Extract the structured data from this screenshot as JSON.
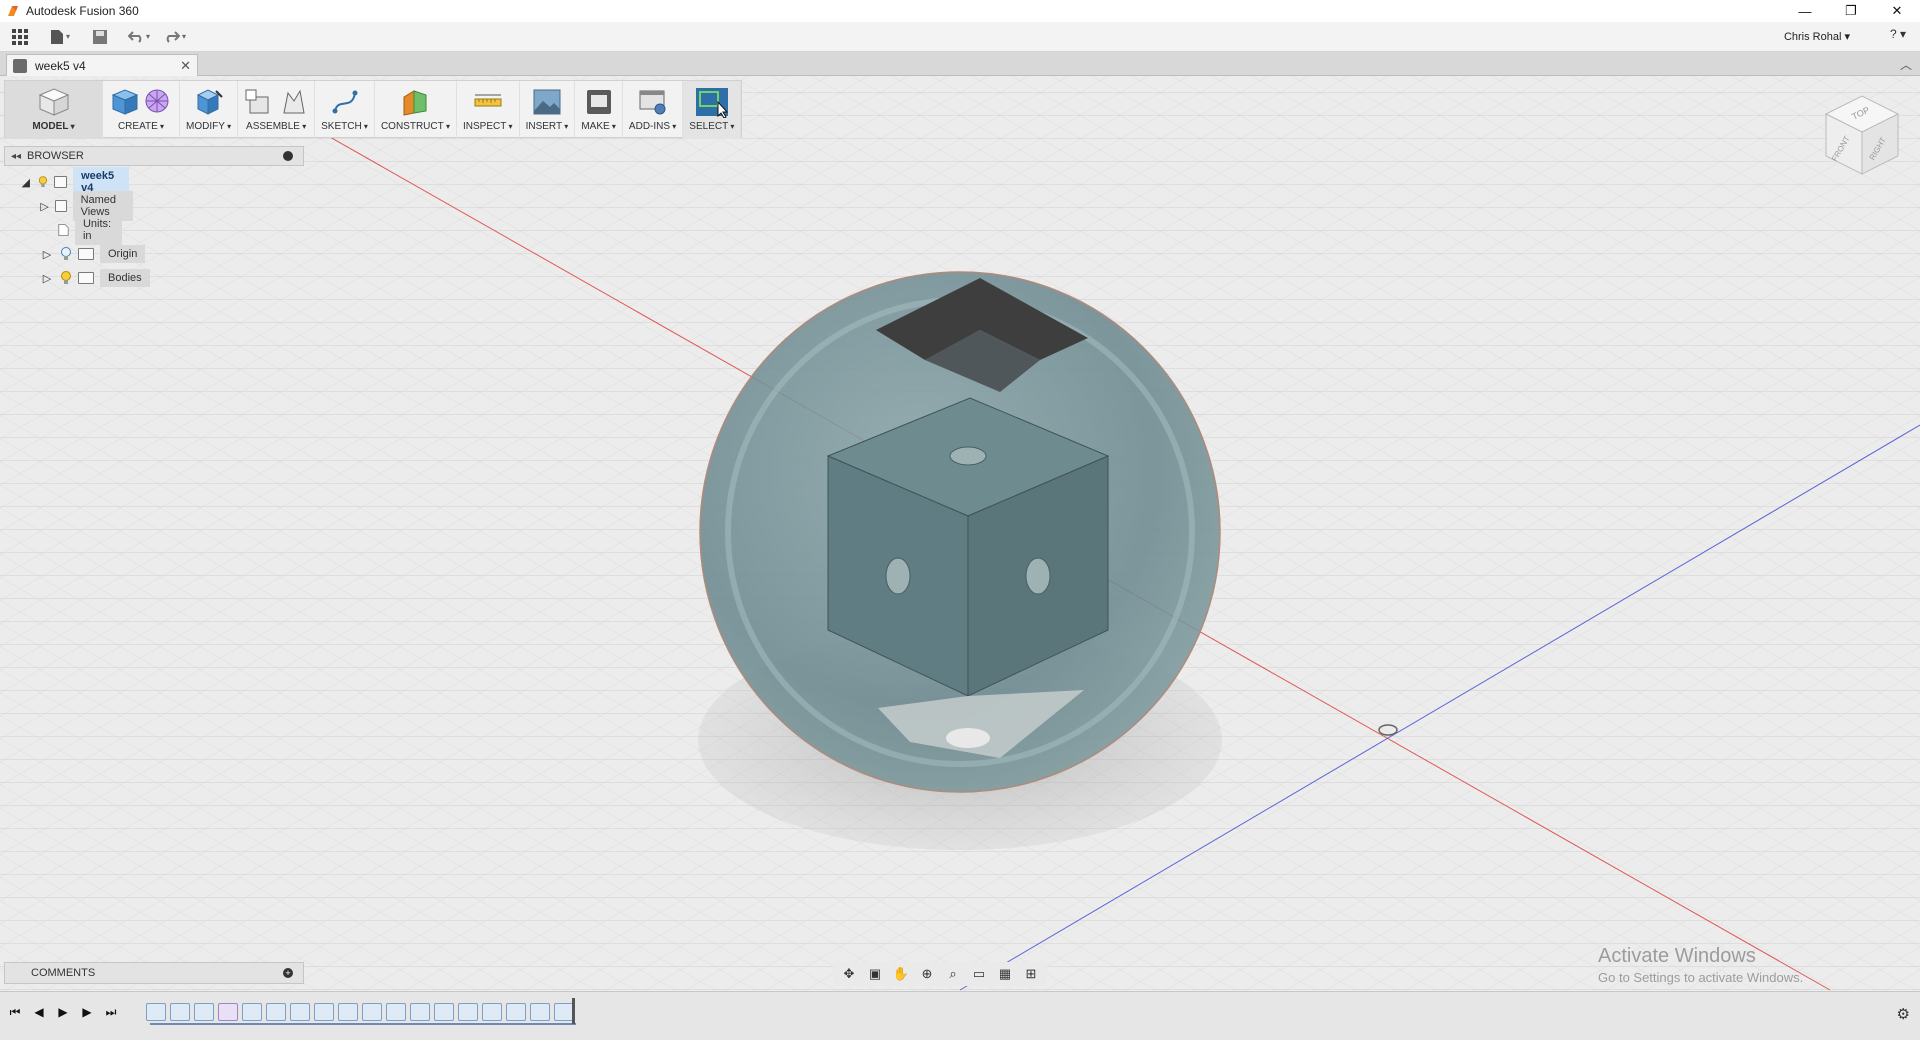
{
  "window": {
    "title": "Autodesk Fusion 360",
    "controls": {
      "minimize": "—",
      "restore": "❐",
      "close": "✕"
    }
  },
  "quick_access": {
    "grid_icon": "app-grid-icon",
    "file_icon": "file-icon",
    "save_icon": "save-icon",
    "undo_icon": "undo-icon",
    "redo_icon": "redo-icon",
    "user": "Chris Rohal ▾",
    "help": "? ▾"
  },
  "document_tab": {
    "label": "week5 v4",
    "close": "✕"
  },
  "toolbar": {
    "groups": [
      {
        "label": "MODEL"
      },
      {
        "label": "CREATE"
      },
      {
        "label": "MODIFY"
      },
      {
        "label": "ASSEMBLE"
      },
      {
        "label": "SKETCH"
      },
      {
        "label": "CONSTRUCT"
      },
      {
        "label": "INSPECT"
      },
      {
        "label": "INSERT"
      },
      {
        "label": "MAKE"
      },
      {
        "label": "ADD-INS"
      },
      {
        "label": "SELECT"
      }
    ]
  },
  "browser": {
    "header": "BROWSER",
    "tree": [
      {
        "label": "week5 v4"
      },
      {
        "label": "Named Views"
      },
      {
        "label": "Units: in"
      },
      {
        "label": "Origin"
      },
      {
        "label": "Bodies"
      }
    ]
  },
  "viewcube": {
    "top": "TOP",
    "front": "FRONT",
    "right": "RIGHT"
  },
  "comments": {
    "label": "COMMENTS"
  },
  "watermark": {
    "line1": "Activate Windows",
    "line2": "Go to Settings to activate Windows."
  },
  "colors": {
    "accent": "#2f6fa8",
    "sphere": "#6f8d92",
    "body": "#5c7a80",
    "axis_red": "#e05858",
    "axis_blue": "#5a63d6"
  }
}
